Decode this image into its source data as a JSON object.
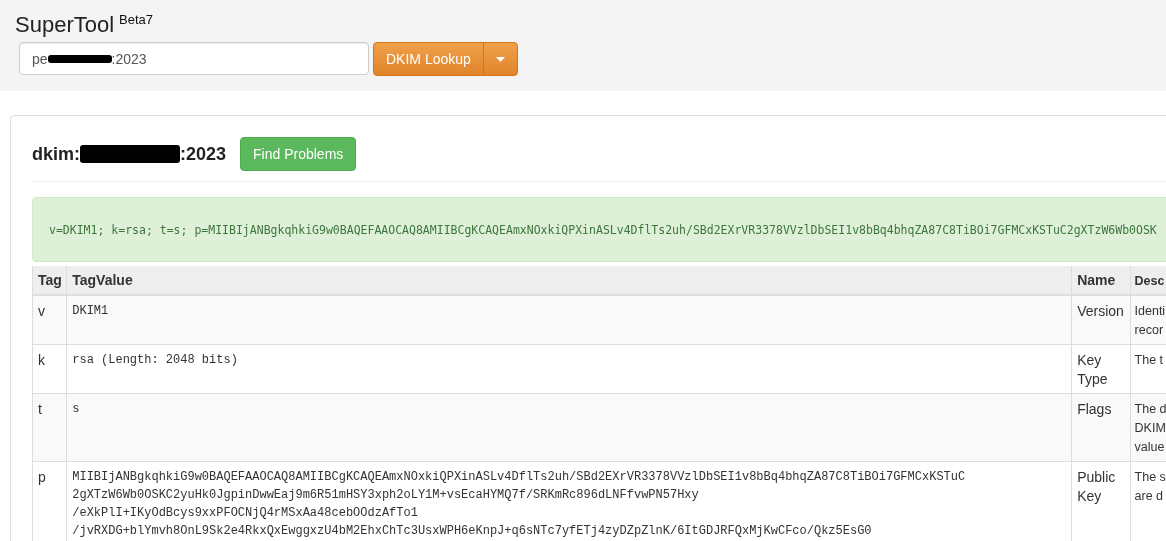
{
  "app": {
    "title": "SuperTool",
    "badge": "Beta7"
  },
  "search": {
    "value_start": "pe",
    "value_end": ":2023",
    "redacted": true
  },
  "lookup_button": {
    "label": "DKIM Lookup"
  },
  "result": {
    "heading_start": "dkim:",
    "heading_end": ":2023",
    "redacted": true,
    "action": "Find Problems",
    "record": "v=DKIM1; k=rsa; t=s; p=MIIBIjANBgkqhkiG9w0BAQEFAAOCAQ8AMIIBCgKCAQEAmxNOxkiQPXinASLv4DflTs2uh/SBd2EXrVR3378VVzlDbSEI1v8bBq4bhqZA87C8TiBOi7GFMCxKSTuC2gXTzW6Wb0OSK"
  },
  "table": {
    "columns": [
      "Tag",
      "TagValue",
      "Name",
      "Desc"
    ],
    "rows": [
      {
        "tag": "v",
        "value": [
          "DKIM1"
        ],
        "name": [
          "Version"
        ],
        "desc": [
          "Identi",
          "recor"
        ]
      },
      {
        "tag": "k",
        "value": [
          "rsa (Length: 2048 bits)"
        ],
        "name": [
          "Key",
          "Type"
        ],
        "desc": [
          "The t"
        ]
      },
      {
        "tag": "t",
        "value": [
          "s"
        ],
        "name": [
          "Flags"
        ],
        "desc": [
          "The d",
          "DKIM",
          "value"
        ]
      },
      {
        "tag": "p",
        "value": [
          "MIIBIjANBgkqhkiG9w0BAQEFAAOCAQ8AMIIBCgKCAQEAmxNOxkiQPXinASLv4DflTs2uh/SBd2EXrVR3378VVzlDbSEI1v8bBq4bhqZA87C8TiBOi7GFMCxKSTuC",
          "2gXTzW6Wb0OSKC2yuHk0JgpinDwwEaj9m6R51mHSY3xph2oLY1M+vsEcaHYMQ7f/SRKmRc896dLNFfvwPN57Hxy",
          "/eXkPlI+IKyOdBcys9xxPFOCNjQ4rMSxAa48cebOOdzAfTo1",
          "/jvRXDG+blYmvh8OnL9Sk2e4RkxQxEwggxzU4bM2EhxChTc3UsxWPH6eKnpJ+q6sNTc7yfETj4zyDZpZlnK/6ItGDJRFQxMjKwCFco/Qkz5EsG0"
        ],
        "name": [
          "Public",
          "Key"
        ],
        "desc": [
          "The s",
          "are d"
        ]
      }
    ]
  }
}
